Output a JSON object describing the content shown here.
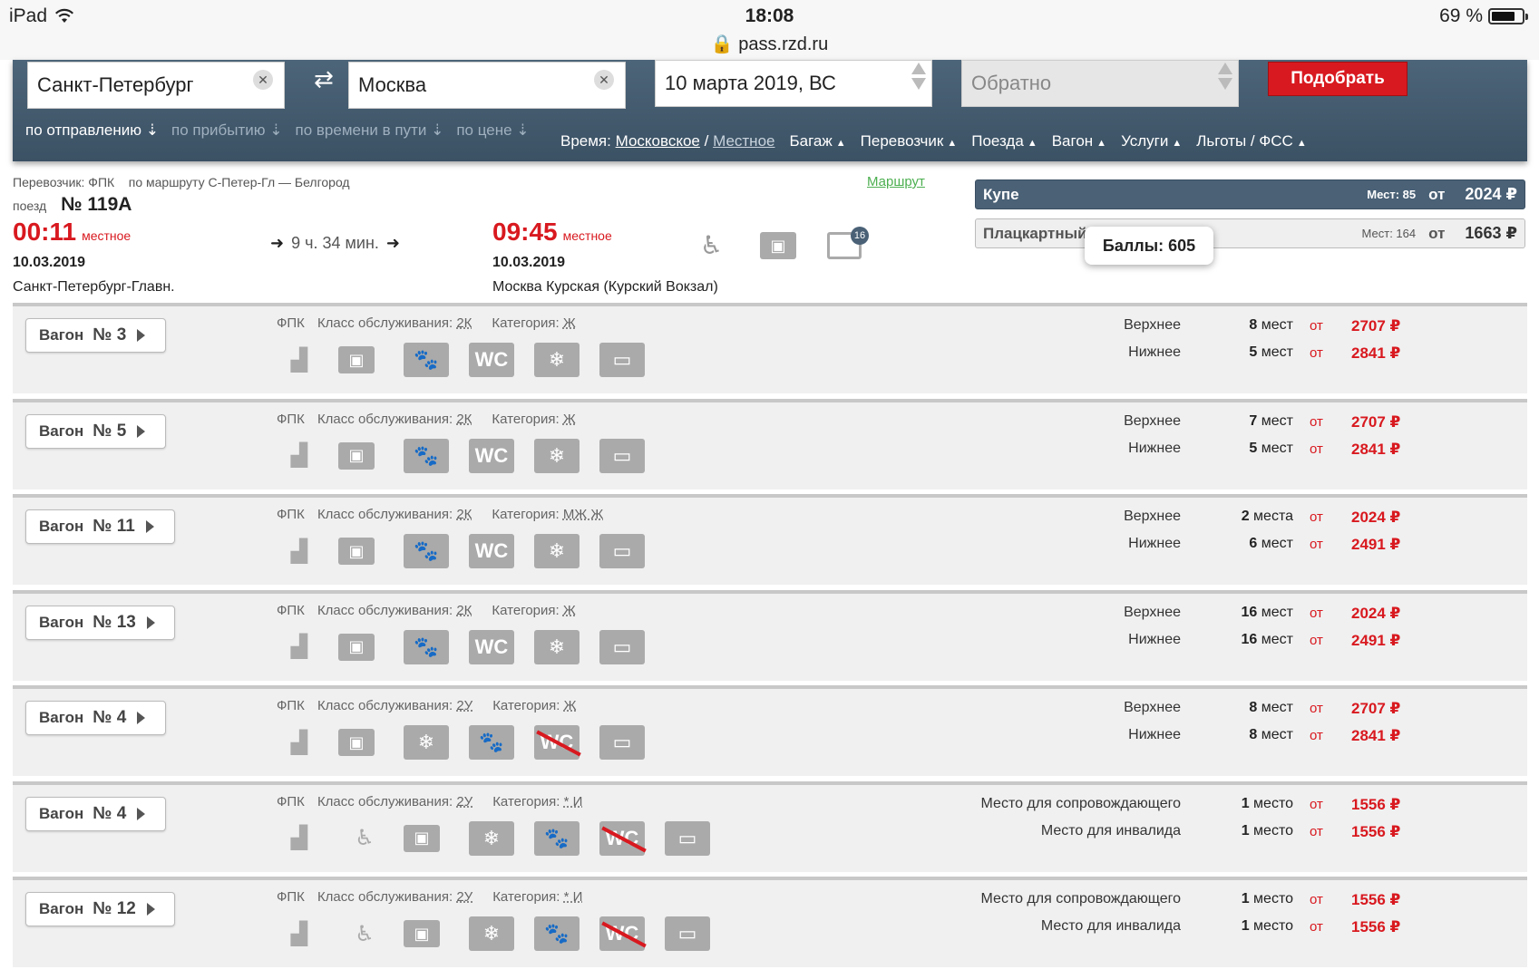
{
  "status": {
    "device": "iPad",
    "time": "18:08",
    "url": "pass.rzd.ru",
    "battery": "69 %",
    "battery_fill": 0.69
  },
  "search": {
    "from": "Санкт-Петербург",
    "to": "Москва",
    "date": "10 марта 2019, ВС",
    "return_placeholder": "Обратно",
    "submit": "Подобрать"
  },
  "sorts": [
    "по отправлению",
    "по прибытию",
    "по времени в пути",
    "по цене"
  ],
  "filters": {
    "time_label": "Время:",
    "time_moscow": "Московское",
    "sep": "/",
    "time_local": "Местное",
    "items": [
      "Багаж",
      "Перевозчик",
      "Поезда",
      "Вагон",
      "Услуги",
      "Льготы / ФСС"
    ]
  },
  "train": {
    "carrier": "Перевозчик: ФПК",
    "route": "по маршруту С-Петер-Гл — Белгород",
    "route_link": "Маршрут",
    "label": "поезд",
    "number": "№ 119А",
    "dep_time": "00:11",
    "dep_note": "местное",
    "dep_date": "10.03.2019",
    "dep_station": "Санкт-Петербург-Главн.",
    "duration": "9 ч. 34 мин.",
    "arr_time": "09:45",
    "arr_note": "местное",
    "arr_date": "10.03.2019",
    "arr_station": "Москва Курская (Курский Вокзал)",
    "badge": "16"
  },
  "classes": [
    {
      "name": "Купе",
      "seats": "Мест: 85",
      "ot": "от",
      "price": "2024 ₽"
    },
    {
      "name": "Плацкартный",
      "seats": "Мест: 164",
      "ot": "от",
      "price": "1663 ₽"
    }
  ],
  "tooltip": "Баллы: 605",
  "cars": [
    {
      "label": "Вагон",
      "num": "№ 3",
      "carrier": "ФПК",
      "class_label": "Класс обслуживания:",
      "class": "2К",
      "cat_label": "Категория:",
      "cat": "Ж",
      "seats": [
        {
          "name": "Верхнее",
          "count": "8",
          "unit": "мест",
          "ot": "от",
          "price": "2707 ₽"
        },
        {
          "name": "Нижнее",
          "count": "5",
          "unit": "мест",
          "ot": "от",
          "price": "2841 ₽"
        }
      ]
    },
    {
      "label": "Вагон",
      "num": "№ 5",
      "carrier": "ФПК",
      "class_label": "Класс обслуживания:",
      "class": "2К",
      "cat_label": "Категория:",
      "cat": "Ж",
      "seats": [
        {
          "name": "Верхнее",
          "count": "7",
          "unit": "мест",
          "ot": "от",
          "price": "2707 ₽"
        },
        {
          "name": "Нижнее",
          "count": "5",
          "unit": "мест",
          "ot": "от",
          "price": "2841 ₽"
        }
      ]
    },
    {
      "label": "Вагон",
      "num": "№ 11",
      "carrier": "ФПК",
      "class_label": "Класс обслуживания:",
      "class": "2К",
      "cat_label": "Категория:",
      "cat": "МЖ Ж",
      "seats": [
        {
          "name": "Верхнее",
          "count": "2",
          "unit": "места",
          "ot": "от",
          "price": "2024 ₽"
        },
        {
          "name": "Нижнее",
          "count": "6",
          "unit": "мест",
          "ot": "от",
          "price": "2491 ₽"
        }
      ]
    },
    {
      "label": "Вагон",
      "num": "№ 13",
      "carrier": "ФПК",
      "class_label": "Класс обслуживания:",
      "class": "2К",
      "cat_label": "Категория:",
      "cat": "Ж",
      "seats": [
        {
          "name": "Верхнее",
          "count": "16",
          "unit": "мест",
          "ot": "от",
          "price": "2024 ₽"
        },
        {
          "name": "Нижнее",
          "count": "16",
          "unit": "мест",
          "ot": "от",
          "price": "2491 ₽"
        }
      ]
    },
    {
      "label": "Вагон",
      "num": "№ 4",
      "carrier": "ФПК",
      "class_label": "Класс обслуживания:",
      "class": "2У",
      "cat_label": "Категория:",
      "cat": "Ж",
      "seats": [
        {
          "name": "Верхнее",
          "count": "8",
          "unit": "мест",
          "ot": "от",
          "price": "2707 ₽"
        },
        {
          "name": "Нижнее",
          "count": "8",
          "unit": "мест",
          "ot": "от",
          "price": "2841 ₽"
        }
      ]
    },
    {
      "label": "Вагон",
      "num": "№ 4",
      "carrier": "ФПК",
      "class_label": "Класс обслуживания:",
      "class": "2У",
      "cat_label": "Категория:",
      "cat": "* И",
      "seats": [
        {
          "name": "Место для сопровождающего",
          "count": "1",
          "unit": "место",
          "ot": "от",
          "price": "1556 ₽"
        },
        {
          "name": "Место для инвалида",
          "count": "1",
          "unit": "место",
          "ot": "от",
          "price": "1556 ₽"
        }
      ]
    },
    {
      "label": "Вагон",
      "num": "№ 12",
      "carrier": "ФПК",
      "class_label": "Класс обслуживания:",
      "class": "2У",
      "cat_label": "Категория:",
      "cat": "* И",
      "seats": [
        {
          "name": "Место для сопровождающего",
          "count": "1",
          "unit": "место",
          "ot": "от",
          "price": "1556 ₽"
        },
        {
          "name": "Место для инвалида",
          "count": "1",
          "unit": "место",
          "ot": "от",
          "price": "1556 ₽"
        }
      ]
    }
  ],
  "icon_glyphs": {
    "wc": "WC",
    "snow": "❄",
    "paw": "🐾",
    "bag": "▣",
    "pillow": "▭",
    "chart": "▟",
    "wheelchair": "♿"
  }
}
